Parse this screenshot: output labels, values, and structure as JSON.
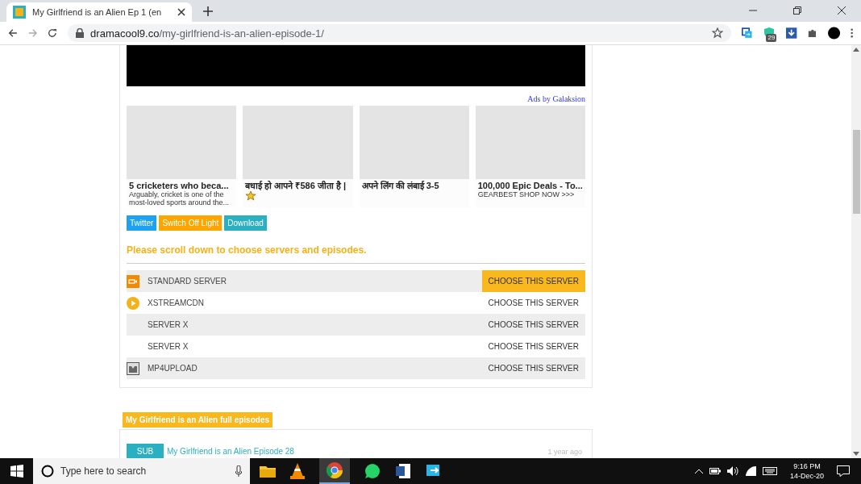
{
  "browser": {
    "tab": {
      "title": "My Girlfriend is an Alien Ep 1 (en"
    },
    "address": {
      "domain": "dramacool9.co",
      "path": "/my-girlfriend-is-an-alien-episode-1/"
    },
    "extension_badge": "29"
  },
  "page": {
    "ads_label": "Ads by Galaksion",
    "ads": [
      {
        "title": "5 cricketers who beca...",
        "description": "Arguably, cricket is one of the most-loved sports around the..."
      },
      {
        "title": "बधाई हो आपने ₹586 जीता है |",
        "star": true
      },
      {
        "title": "अपने लिंग की लंबाई 3-5"
      },
      {
        "title": "100,000 Epic Deals - To...",
        "description": "GEARBEST SHOP NOW >>>"
      }
    ],
    "share_buttons": [
      {
        "label": "Twitter",
        "color": "#1da1f2"
      },
      {
        "label": "Switch Off Light",
        "color": "#ffa500"
      },
      {
        "label": "Download",
        "color": "#2bb0c1"
      }
    ],
    "notice": "Please scroll down to choose servers and episodes.",
    "servers": [
      {
        "name": "STANDARD SERVER",
        "kind": "camera",
        "selected": true,
        "action": "CHOOSE THIS SERVER"
      },
      {
        "name": "XSTREAMCDN",
        "kind": "play",
        "selected": false,
        "action": "CHOOSE THIS SERVER"
      },
      {
        "name": "SERVER X",
        "selected": false,
        "action": "CHOOSE THIS SERVER"
      },
      {
        "name": "SERVER X",
        "selected": false,
        "action": "CHOOSE THIS SERVER"
      },
      {
        "name": "MP4UPLOAD",
        "kind": "film",
        "selected": false,
        "action": "CHOOSE THIS SERVER"
      }
    ],
    "episodes_header": "My Girlfriend is an Alien full episodes",
    "episodes": [
      {
        "badge": "SUB",
        "title": "My Girlfriend is an Alien Episode 28",
        "time": "1 year ago"
      }
    ]
  },
  "taskbar": {
    "search_placeholder": "Type here to search",
    "time": "9:16 PM",
    "date": "14-Dec-20"
  }
}
